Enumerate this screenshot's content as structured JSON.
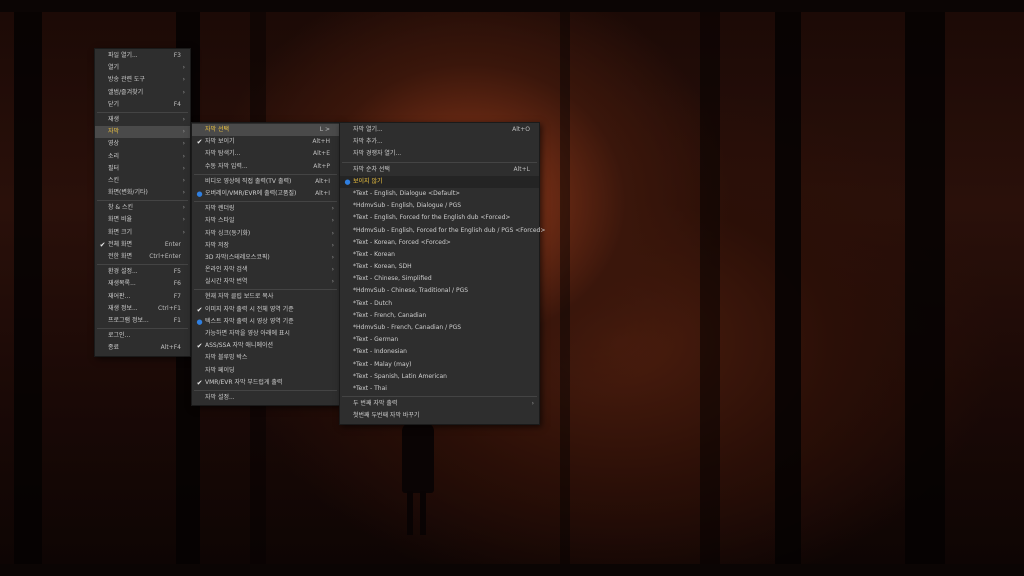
{
  "menu1": {
    "items": [
      {
        "label": "파일 열기...",
        "shortcut": "F3"
      },
      {
        "label": "열기",
        "arrow": "›"
      },
      {
        "label": "방송 관련 도구",
        "arrow": "›"
      },
      {
        "label": "앨범/즐겨찾기",
        "arrow": "›"
      },
      {
        "label": "닫기",
        "shortcut": "F4"
      },
      {
        "label": "재생",
        "arrow": "›"
      },
      {
        "label": "자막",
        "arrow": "›"
      },
      {
        "label": "영상",
        "arrow": "›"
      },
      {
        "label": "소리",
        "arrow": "›"
      },
      {
        "label": "필터",
        "arrow": "›"
      },
      {
        "label": "스킨",
        "arrow": "›"
      },
      {
        "label": "화면(변화/기타)",
        "arrow": "›"
      },
      {
        "label": "창 & 스킨",
        "arrow": "›"
      },
      {
        "label": "화면 비율",
        "arrow": "›"
      },
      {
        "label": "화면 크기",
        "arrow": "›"
      },
      {
        "label": "전체 화면",
        "shortcut": "Enter",
        "mark": "✔"
      },
      {
        "label": "전한 화면",
        "shortcut": "Ctrl+Enter"
      },
      {
        "label": "환경 설정...",
        "shortcut": "F5"
      },
      {
        "label": "재생목록...",
        "shortcut": "F6"
      },
      {
        "label": "재어판...",
        "shortcut": "F7"
      },
      {
        "label": "재생 정보...",
        "shortcut": "Ctrl+F1"
      },
      {
        "label": "프로그램 정보...",
        "shortcut": "F1"
      },
      {
        "label": "로그인..."
      },
      {
        "label": "종료",
        "shortcut": "Alt+F4"
      }
    ]
  },
  "menu2": {
    "items": [
      {
        "label": "자막 선택",
        "shortcut": "L >"
      },
      {
        "label": "자막 보이기",
        "shortcut": "Alt+H",
        "mark": "✔"
      },
      {
        "label": "자막 탐색기...",
        "shortcut": "Alt+E"
      },
      {
        "label": "수동 자막 입력...",
        "shortcut": "Alt+P"
      },
      {
        "label": "비디오 영상에 직접 출력(TV 출력)",
        "shortcut": "Alt+I"
      },
      {
        "label": "오버레이/VMR/EVR에 출력(고품질)",
        "shortcut": "Alt+I",
        "mark": "●"
      },
      {
        "label": "자막 렌더링",
        "arrow": "›"
      },
      {
        "label": "자막 스타일",
        "arrow": "›"
      },
      {
        "label": "자막 싱크(동기화)",
        "arrow": "›"
      },
      {
        "label": "자막 저장",
        "arrow": "›"
      },
      {
        "label": "3D 자막(스테레오스코픽)",
        "arrow": "›"
      },
      {
        "label": "온라인 자막 검색",
        "arrow": "›"
      },
      {
        "label": "실시간 자막 번역",
        "arrow": "›"
      },
      {
        "label": "현재 자막 클립 보드로 복사"
      },
      {
        "label": "이미지 자막 출력 시 전체 영역 기준",
        "mark": "✔"
      },
      {
        "label": "텍스트 자막 출력 시 영상 영역 기준",
        "mark": "●"
      },
      {
        "label": "가능하면 자막을 영상 아래에 표시"
      },
      {
        "label": "ASS/SSA 자막 애니메이션",
        "mark": "✔"
      },
      {
        "label": "자막 블루밍 박스"
      },
      {
        "label": "자막 페이딩"
      },
      {
        "label": "VMR/EVR 자막 부드럽게 출력",
        "mark": "✔"
      },
      {
        "label": "자막 설정..."
      }
    ]
  },
  "menu3": {
    "items": [
      {
        "label": "자막 열기...",
        "shortcut": "Alt+O"
      },
      {
        "label": "자막 추가..."
      },
      {
        "label": "자막 경쟁자 열기..."
      },
      {
        "label": "자막 순차 선택",
        "shortcut": "Alt+L"
      },
      {
        "label": "보이지 않기",
        "mark": "●"
      },
      {
        "label": "*Text - English, Dialogue <Default>"
      },
      {
        "label": "*HdmvSub - English, Dialogue / PGS"
      },
      {
        "label": "*Text - English, Forced for the English dub <Forced>"
      },
      {
        "label": "*HdmvSub - English, Forced for the English dub / PGS <Forced>"
      },
      {
        "label": "*Text - Korean, Forced <Forced>"
      },
      {
        "label": "*Text - Korean"
      },
      {
        "label": "*Text - Korean, SDH"
      },
      {
        "label": "*Text - Chinese, Simplified"
      },
      {
        "label": "*HdmvSub - Chinese, Traditional / PGS"
      },
      {
        "label": "*Text - Dutch"
      },
      {
        "label": "*Text - French, Canadian"
      },
      {
        "label": "*HdmvSub - French, Canadian / PGS"
      },
      {
        "label": "*Text - German"
      },
      {
        "label": "*Text - Indonesian"
      },
      {
        "label": "*Text - Malay (may)"
      },
      {
        "label": "*Text - Spanish, Latin American"
      },
      {
        "label": "*Text - Thai"
      },
      {
        "label": "두 번째 자막 출력",
        "arrow": "›"
      },
      {
        "label": "첫번째 두번째 자막 바꾸기"
      }
    ]
  }
}
